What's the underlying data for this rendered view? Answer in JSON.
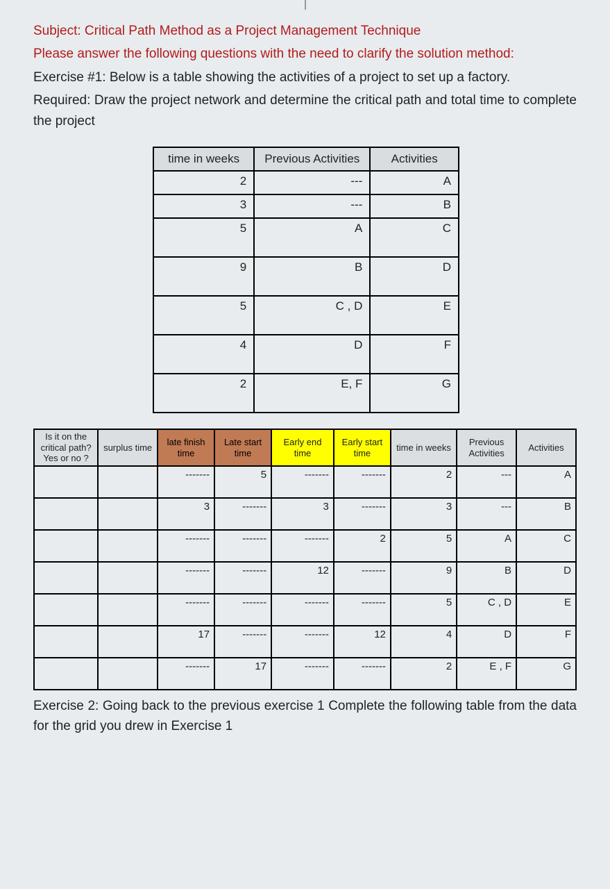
{
  "heading": {
    "subject": "Subject: Critical Path Method as a Project Management Technique",
    "instruction": "Please answer the following questions with the need to clarify the solution method:",
    "exercise1": "Exercise #1: Below is a table showing the activities of a project to set up a factory.",
    "required": "Required: Draw the project network and determine the critical path and total time to complete the project"
  },
  "table1": {
    "headers": {
      "col1": "time in weeks",
      "col2": "Previous Activities",
      "col3": "Activities"
    },
    "rows": [
      {
        "time": "2",
        "prev": "---",
        "act": "A",
        "tall": false
      },
      {
        "time": "3",
        "prev": "---",
        "act": "B",
        "tall": false
      },
      {
        "time": "5",
        "prev": "A",
        "act": "C",
        "tall": true
      },
      {
        "time": "9",
        "prev": "B",
        "act": "D",
        "tall": true
      },
      {
        "time": "5",
        "prev": "C , D",
        "act": "E",
        "tall": true
      },
      {
        "time": "4",
        "prev": "D",
        "act": "F",
        "tall": true
      },
      {
        "time": "2",
        "prev": "E, F",
        "act": "G",
        "tall": true
      }
    ]
  },
  "table2": {
    "headers": {
      "h1": "Is it on the critical path? Yes or no ?",
      "h2": "surplus time",
      "h3": "late finish time",
      "h4": "Late start time",
      "h5": "Early  end time",
      "h6": "Early start time",
      "h7": "time in weeks",
      "h8": "Previous Activities",
      "h9": "Activities"
    },
    "rows": [
      {
        "c1": "",
        "c2": "",
        "c3": "-------",
        "c4": "5",
        "c5": "-------",
        "c6": "-------",
        "c7": "2",
        "c8": "---",
        "c9": "A"
      },
      {
        "c1": "",
        "c2": "",
        "c3": "3",
        "c4": "-------",
        "c5": "3",
        "c6": "-------",
        "c7": "3",
        "c8": "---",
        "c9": "B"
      },
      {
        "c1": "",
        "c2": "",
        "c3": "-------",
        "c4": "-------",
        "c5": "-------",
        "c6": "2",
        "c7": "5",
        "c8": "A",
        "c9": "C"
      },
      {
        "c1": "",
        "c2": "",
        "c3": "-------",
        "c4": "-------",
        "c5": "12",
        "c6": "-------",
        "c7": "9",
        "c8": "B",
        "c9": "D"
      },
      {
        "c1": "",
        "c2": "",
        "c3": "-------",
        "c4": "-------",
        "c5": "-------",
        "c6": "-------",
        "c7": "5",
        "c8": "C , D",
        "c9": "E"
      },
      {
        "c1": "",
        "c2": "",
        "c3": "17",
        "c4": "-------",
        "c5": "-------",
        "c6": "12",
        "c7": "4",
        "c8": "D",
        "c9": "F"
      },
      {
        "c1": "",
        "c2": "",
        "c3": "-------",
        "c4": "17",
        "c5": "-------",
        "c6": "-------",
        "c7": "2",
        "c8": "E , F",
        "c9": "G"
      }
    ]
  },
  "footer": {
    "exercise2": "Exercise 2: Going back to the previous exercise 1 Complete the following table from the data for the grid you drew in Exercise 1"
  }
}
